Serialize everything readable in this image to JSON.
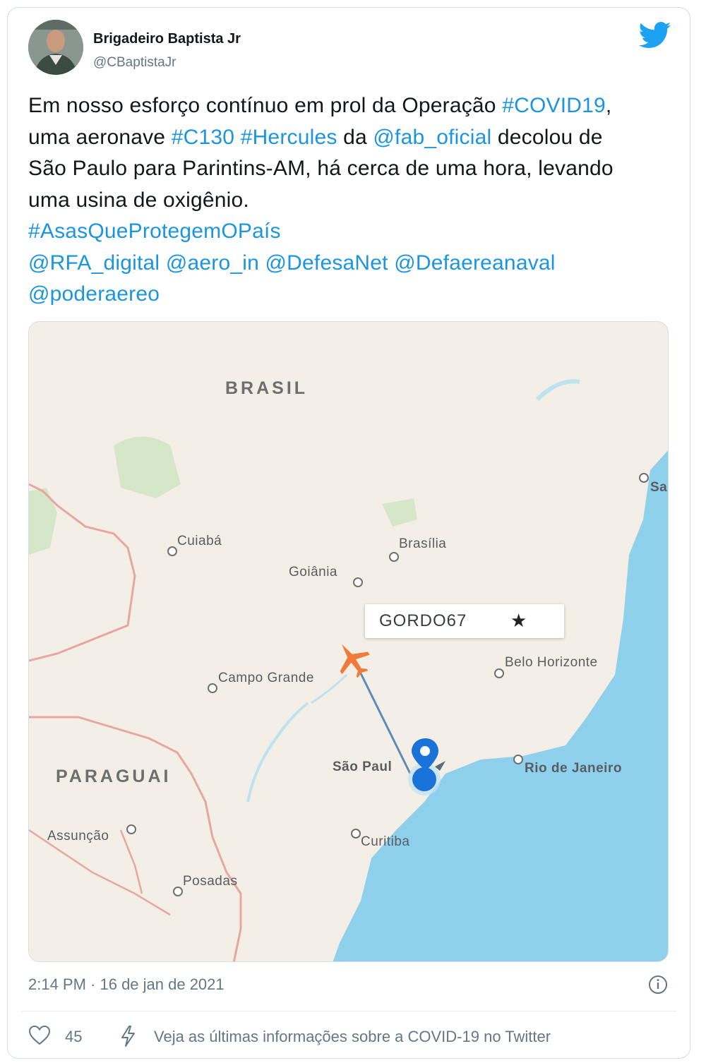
{
  "user": {
    "name": "Brigadeiro Baptista Jr",
    "handle": "@CBaptistaJr"
  },
  "tweet": {
    "line1_pre": "Em nosso esforço contínuo em prol da Operação ",
    "line1_tag": "#COVID19",
    "line1_post": ",",
    "line2_pre": "uma aeronave ",
    "line2_tag1": "#C130",
    "line2_tag2": "#Hercules",
    "line2_mid": " da ",
    "line2_mention": "@fab_oficial",
    "line2_post": " decolou de",
    "line3": "São Paulo para Parintins-AM, há cerca de uma hora, levando",
    "line4": "uma usina de oxigênio.",
    "hashtag": "#AsasQueProtegemOPaís",
    "mentions": [
      "@RFA_digital",
      "@aero_in",
      "@DefesaNet",
      "@Defaereanaval",
      "@poderaereo"
    ]
  },
  "map": {
    "countries": {
      "brasil": "BRASIL",
      "paraguai": "PARAGUAI"
    },
    "cities": {
      "cuiaba": "Cuiabá",
      "brasilia": "Brasília",
      "goiania": "Goiânia",
      "campo_grande": "Campo Grande",
      "belo_horizonte": "Belo Horizonte",
      "sao_paulo": "São Paul",
      "rio": "Rio de Janeiro",
      "assuncao": "Assunção",
      "curitiba": "Curitiba",
      "posadas": "Posadas",
      "salvador_partial": "Sa"
    },
    "flight_callsign": "GORDO67",
    "star_glyph": "★"
  },
  "footer": {
    "timestamp": "2:14 PM · 16 de jan de 2021",
    "likes": "45",
    "covid_info": "Veja as últimas informações sobre a COVID-19 no Twitter"
  },
  "colors": {
    "link": "#1b95e0",
    "ocean": "#8fd0ec",
    "land": "#f4efe6",
    "route": "#5b8db8",
    "plane": "#f07a3a",
    "pin": "#1a73d9"
  },
  "icons": [
    "twitter-bird-icon",
    "info-icon",
    "heart-icon",
    "bolt-icon",
    "airplane-icon",
    "location-pin-icon",
    "star-icon"
  ]
}
